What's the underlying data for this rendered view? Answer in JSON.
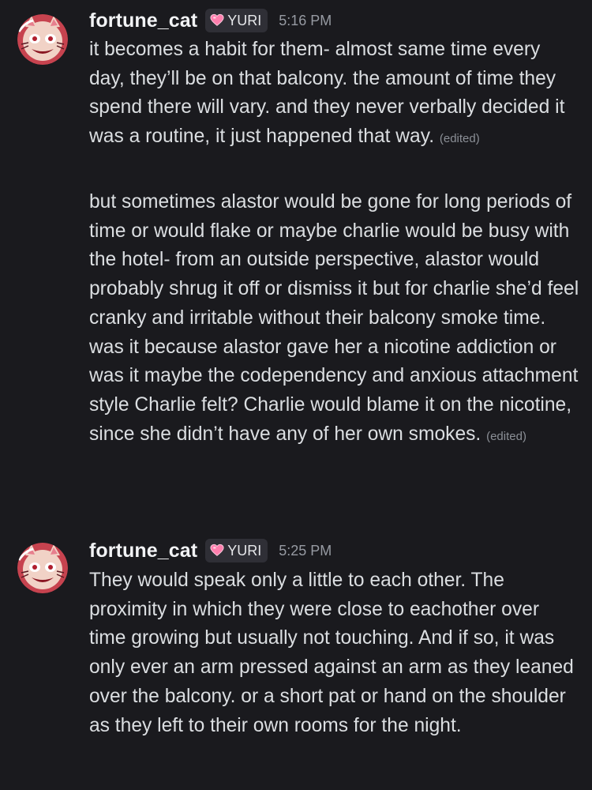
{
  "messages": [
    {
      "username": "fortune_cat",
      "tag": "YURI",
      "time": "5:16 PM",
      "paragraphs": [
        {
          "text": "it becomes a habit for them- almost same time every day, they’ll be on that balcony. the amount of time they spend there will vary. and they never verbally decided it was a routine, it just happened that way.",
          "edited": "(edited)"
        },
        {
          "text": "but sometimes alastor would be gone for long periods of time or would flake or maybe charlie would be busy with the hotel- from an outside perspective, alastor would probably shrug it off or dismiss it but for charlie she’d feel cranky and irritable without their balcony smoke time. was it because alastor gave her a nicotine addiction or was it maybe the codependency and anxious attachment style Charlie felt? Charlie would blame it on the nicotine, since she didn’t have any of her own smokes.",
          "edited": "(edited)"
        }
      ]
    },
    {
      "username": "fortune_cat",
      "tag": "YURI",
      "time": "5:25 PM",
      "paragraphs": [
        {
          "text": "They would speak only a little to each other. The proximity in which they were close to eachother over time growing but usually not touching. And if so, it was only ever an arm pressed against an arm as they leaned over the balcony. or a short pat or hand on the shoulder as they left to their own rooms for the night."
        }
      ]
    }
  ],
  "colors": {
    "background": "#1a1a1e",
    "username": "#f2f3f5",
    "body_text": "#dbdee1",
    "timestamp": "#969aa2",
    "tag_background": "#2f2f36",
    "heart": "#ff7fae"
  },
  "icons": {
    "avatar": "cat-avatar-icon",
    "tag_icon": "heart-icon"
  }
}
